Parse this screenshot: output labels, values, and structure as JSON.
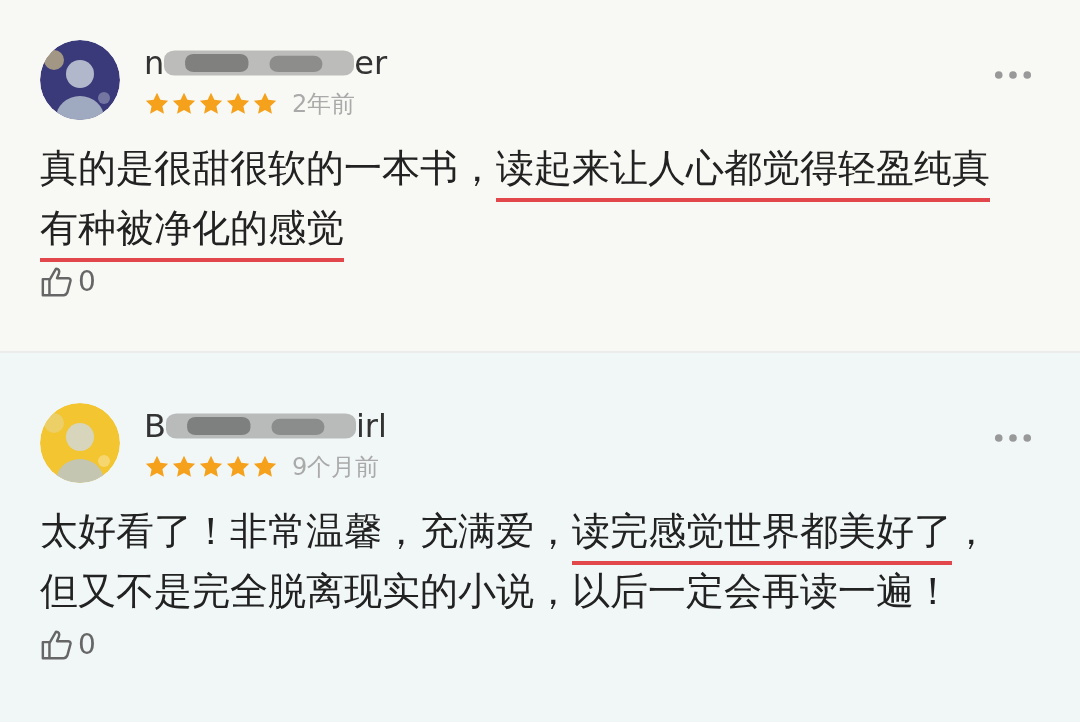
{
  "reviews": [
    {
      "avatar": {
        "color": "#3a3a7a"
      },
      "name_start": "n",
      "name_end": "er",
      "stars": 5,
      "time": "2年前",
      "segments": [
        {
          "text": "真的是很甜很软的一本书，",
          "underlined": false
        },
        {
          "text": "读起来让人心都觉得轻盈纯真有种被净化的感觉",
          "underlined": true
        }
      ],
      "likes": "0"
    },
    {
      "avatar": {
        "color": "#f2c531"
      },
      "name_start": "B",
      "name_end": "irl",
      "stars": 5,
      "time": "9个月前",
      "segments": [
        {
          "text": "太好看了！非常温馨，充满爱，",
          "underlined": false
        },
        {
          "text": "读完感觉世界都美好了",
          "underlined": true
        },
        {
          "text": "，但又不是完全脱离现实的小说，以后一定会再读一遍！",
          "underlined": false
        }
      ],
      "likes": "0"
    }
  ]
}
